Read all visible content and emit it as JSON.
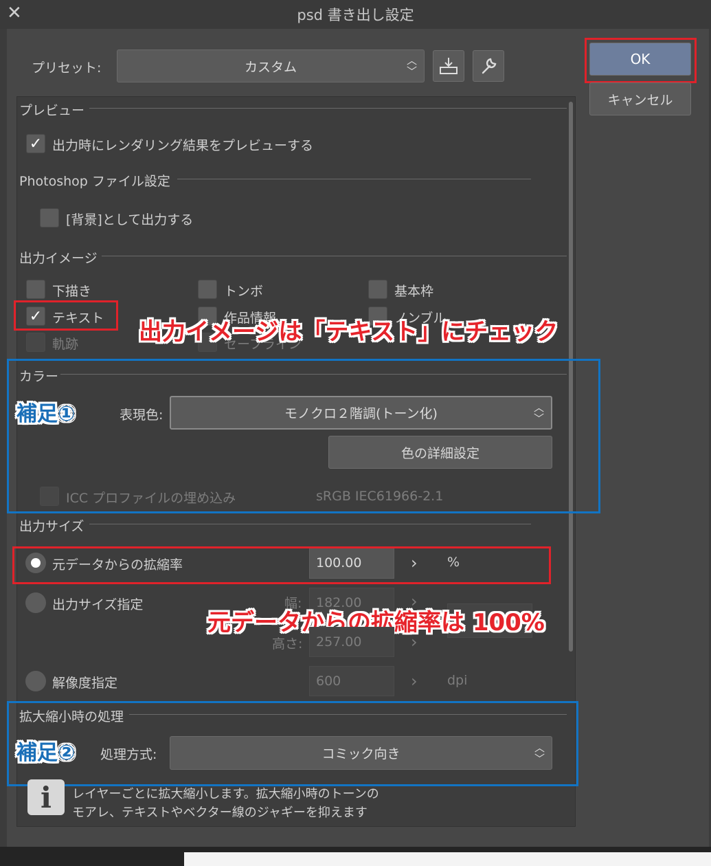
{
  "window": {
    "title": "psd 書き出し設定",
    "close_glyph": "✕"
  },
  "preset": {
    "label": "プリセット:",
    "value": "カスタム",
    "save_icon": "save-preset-icon",
    "settings_icon": "wrench-icon"
  },
  "buttons": {
    "ok": "OK",
    "cancel": "キャンセル"
  },
  "preview": {
    "header": "プレビュー",
    "checkbox_label": "出力時にレンダリング結果をプレビューする",
    "checked": true
  },
  "photoshop": {
    "header": "Photoshop ファイル設定",
    "bg_label": "[背景]として出力する",
    "checked": false
  },
  "output_image": {
    "header": "出力イメージ",
    "items": [
      {
        "label": "下描き",
        "checked": false
      },
      {
        "label": "トンボ",
        "checked": false
      },
      {
        "label": "基本枠",
        "checked": false
      },
      {
        "label": "テキスト",
        "checked": true
      },
      {
        "label": "作品情報",
        "checked": false
      },
      {
        "label": "ノンブル",
        "checked": false
      },
      {
        "label": "軌跡",
        "checked": false
      },
      {
        "label": "セーフライン",
        "checked": false
      }
    ]
  },
  "color": {
    "header": "カラー",
    "expression_label": "表現色:",
    "expression_value": "モノクロ２階調(トーン化)",
    "detail_button": "色の詳細設定",
    "icc_label": "ICC プロファイルの埋め込み",
    "icc_profile": "sRGB IEC61966-2.1"
  },
  "output_size": {
    "header": "出力サイズ",
    "scale_label": "元データからの拡縮率",
    "scale_value": "100.00",
    "scale_unit": "%",
    "size_label": "出力サイズ指定",
    "width_label": "幅:",
    "width_value": "182.00",
    "height_label": "高さ:",
    "height_value": "257.00",
    "resolution_label": "解像度指定",
    "resolution_value": "600",
    "resolution_unit": "dpi",
    "chevron": "›"
  },
  "scaling": {
    "header": "拡大縮小時の処理",
    "method_label": "処理方式:",
    "method_value": "コミック向き",
    "info_line1": "レイヤーごとに拡大縮小します。拡大縮小時のトーンの",
    "info_line2": "モアレ、テキストやベクター線のジャギーを抑えます"
  },
  "annotations": {
    "text_check": "出力イメージは「テキスト」にチェック",
    "scale_note": "元データからの拡縮率は 100%",
    "supplement1": "補足①",
    "supplement2": "補足②"
  },
  "colors": {
    "red_highlight": "#e0222a",
    "blue_highlight": "#1274c4",
    "ok_button": "#6d7e9d"
  }
}
